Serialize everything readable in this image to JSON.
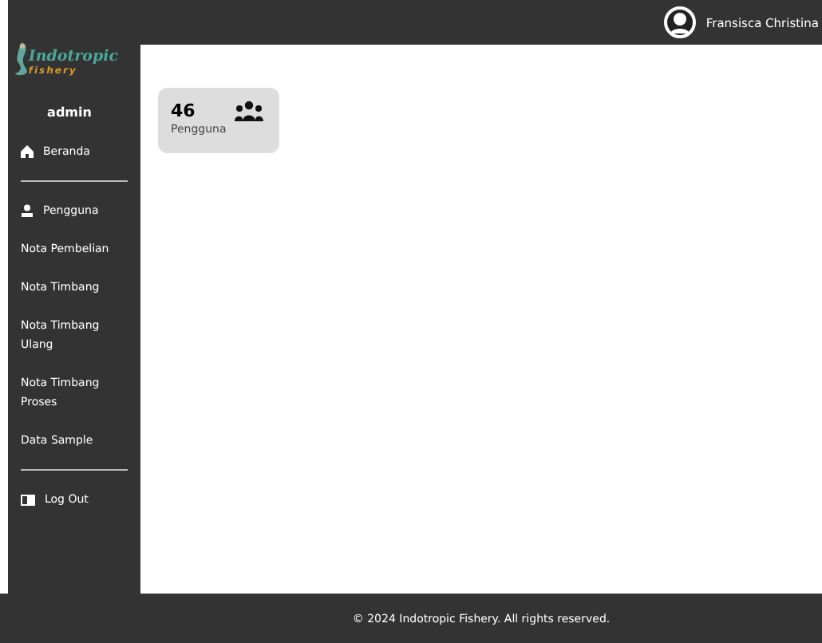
{
  "topbar": {
    "user_name": "Fransisca Christina"
  },
  "sidebar": {
    "logo": {
      "title": "Indotropic",
      "subtitle": "fishery"
    },
    "role": "admin",
    "items": [
      {
        "label": "Beranda",
        "kind": "home",
        "selected": false,
        "divider_after": true
      },
      {
        "label": "Pengguna",
        "kind": "user",
        "selected": false,
        "divider_after": false
      },
      {
        "label": "Nota Pembelian",
        "kind": "plain",
        "selected": false,
        "divider_after": false
      },
      {
        "label": "Nota Timbang",
        "kind": "plain",
        "selected": false,
        "divider_after": false
      },
      {
        "label": "Nota Timbang Ulang",
        "kind": "plain",
        "selected": false,
        "divider_after": false
      },
      {
        "label": "Nota Timbang Proses",
        "kind": "plain",
        "selected": false,
        "divider_after": false
      },
      {
        "label": "Data Sample",
        "kind": "plain",
        "selected": false,
        "divider_after": true
      },
      {
        "label": "Log Out",
        "kind": "logout",
        "selected": false,
        "divider_after": false
      }
    ]
  },
  "cards": [
    {
      "count": "46",
      "label": "Pengguna"
    }
  ],
  "footer": "© 2024 Indotropic Fishery. All rights reserved."
}
